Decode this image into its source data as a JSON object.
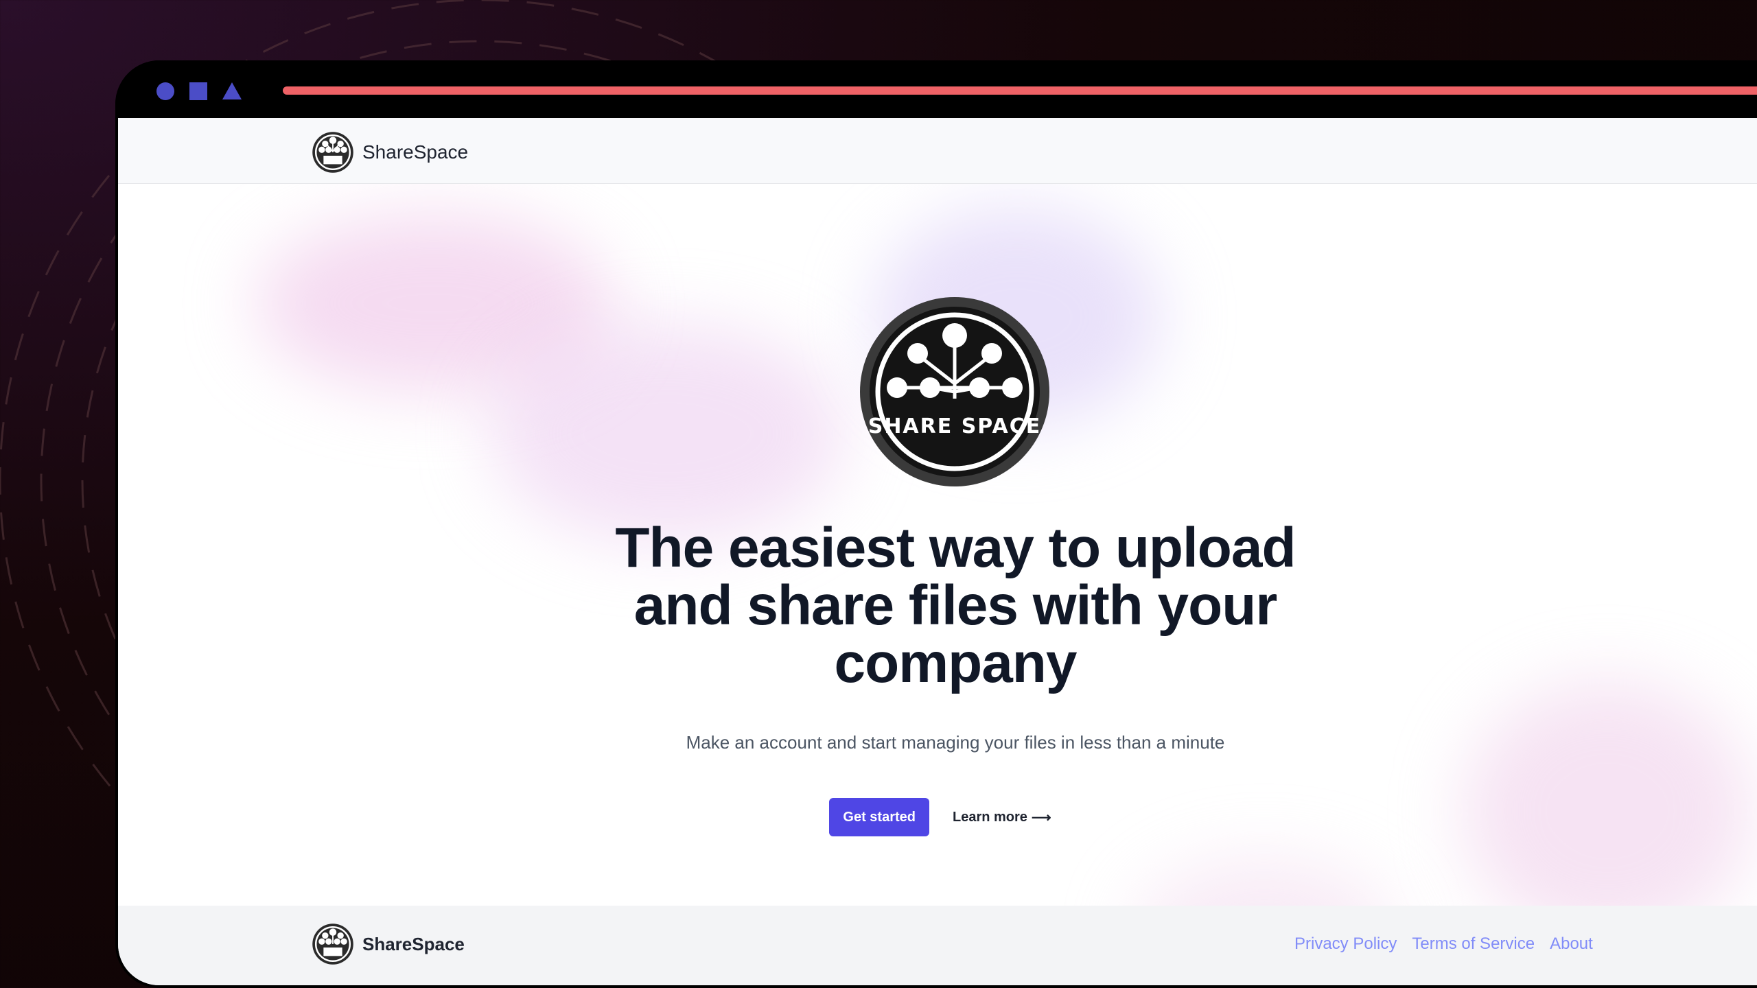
{
  "window_controls": {
    "shapes": [
      "circle",
      "square",
      "triangle"
    ],
    "color": "#4b4dc7"
  },
  "progress_bar": {
    "color": "#ef6266"
  },
  "navbar": {
    "brand_name": "ShareSpace",
    "logo_icon": "sharespace-logo-icon"
  },
  "hero": {
    "logo_text": "SHARE SPACE",
    "headline": "The easiest way to upload and share files with your company",
    "subline": "Make an account and start managing your files in less than a minute",
    "primary_cta": "Get started",
    "secondary_cta": "Learn more",
    "secondary_cta_icon": "arrow-right-icon"
  },
  "footer": {
    "brand_name": "ShareSpace",
    "links": [
      "Privacy Policy",
      "Terms of Service",
      "About"
    ]
  },
  "colors": {
    "accent": "#4f46e5",
    "footer_link": "#818cf8",
    "heading": "#111827"
  }
}
